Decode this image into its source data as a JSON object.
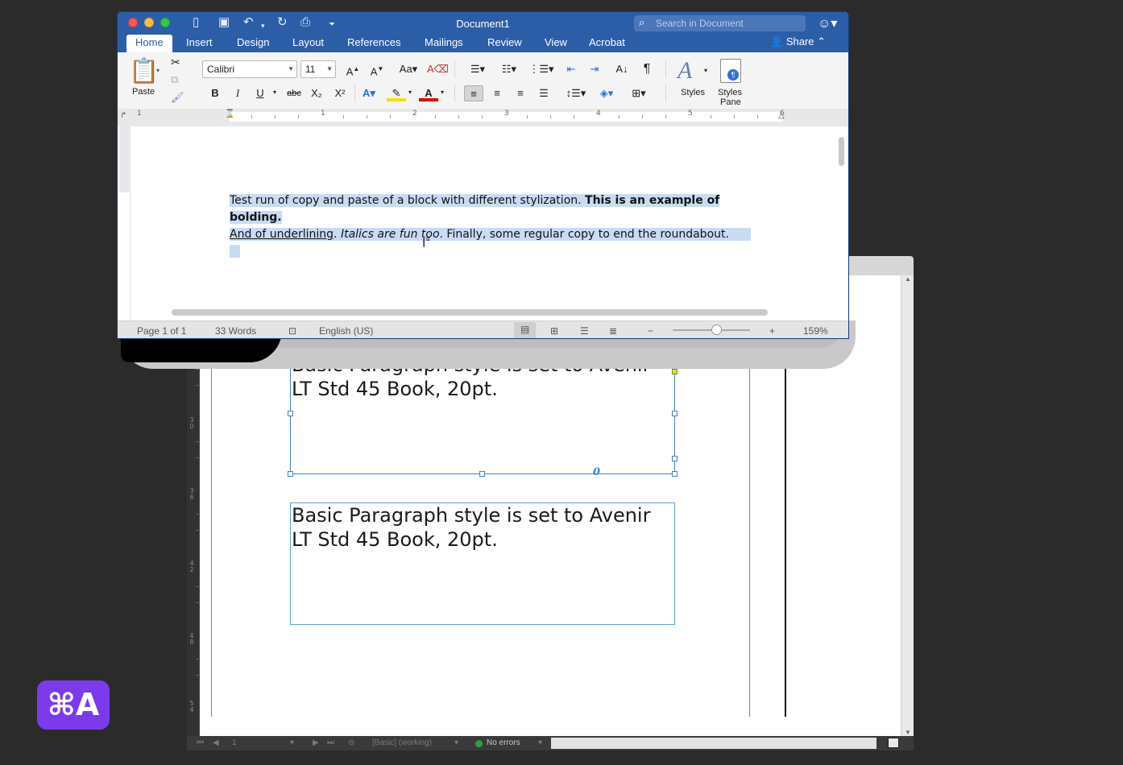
{
  "word": {
    "title": "Document1",
    "search_placeholder": "Search in Document",
    "share_label": "Share",
    "tabs": [
      "Home",
      "Insert",
      "Design",
      "Layout",
      "References",
      "Mailings",
      "Review",
      "View",
      "Acrobat"
    ],
    "ribbon": {
      "paste_label": "Paste",
      "font_name": "Calibri",
      "font_size": "11",
      "styles_label": "Styles",
      "styles_pane_label": "Styles",
      "styles_pane_label2": "Pane",
      "bold": "B",
      "italic": "I",
      "underline": "U",
      "strike": "abc",
      "subscript": "X₂",
      "superscript": "X²",
      "pilcrow": "¶"
    },
    "ruler_numbers": [
      "1",
      "1",
      "2",
      "3",
      "4",
      "5",
      "6"
    ],
    "document": {
      "seg1": "Test run of copy and paste of a block with different stylization. ",
      "seg2": "This is an example of bolding",
      "seg3": ".",
      "seg4": "And of underlining",
      "seg5": ". ",
      "seg6": "Italics are fun too",
      "seg7": ". Finally, some regular copy to end the roundabout."
    },
    "status": {
      "page": "Page 1 of 1",
      "words": "33 Words",
      "language": "English (US)",
      "zoom": "159%"
    }
  },
  "indesign": {
    "frame1_text": "Basic Paragraph style is set to Avenir LT Std 45 Book, 20pt.",
    "frame2_text": "Basic Paragraph style is set to Avenir LT Std 45 Book, 20pt.",
    "ruler_labels": [
      "2 4",
      "3 0",
      "3 6",
      "4 2",
      "4 8",
      "5 4"
    ],
    "top_ruler_label": "6",
    "status": {
      "page": "1",
      "style": "[Basic] (working)",
      "errors": "No errors"
    }
  },
  "shortcut_badge": "⌘A",
  "colors": {
    "word_title_bar": "#2c5ea8",
    "selection": "#c9dbf5",
    "frame_blue": "#3b82d6",
    "margin_guide": "#8b6bd8",
    "badge": "#7c3aed"
  }
}
